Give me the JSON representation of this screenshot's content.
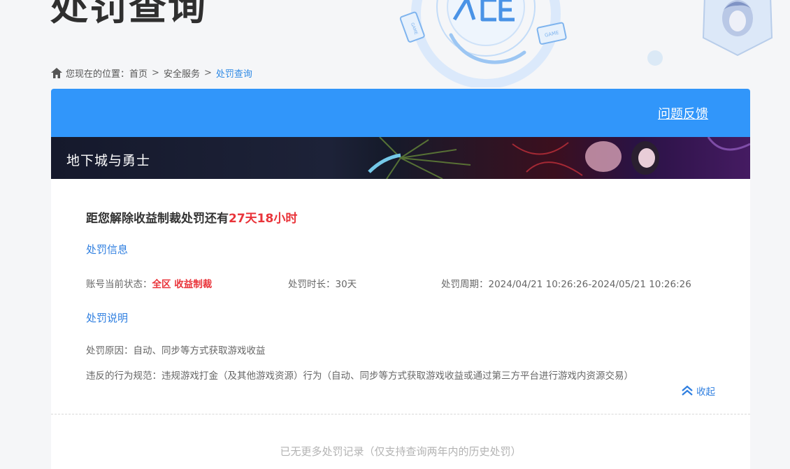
{
  "header": {
    "page_title": "处罚查询"
  },
  "breadcrumb": {
    "prefix": "您现在的位置：",
    "items": [
      "首页",
      "安全服务",
      "处罚查询"
    ],
    "separator": ">"
  },
  "top_bar": {
    "feedback_label": "问题反馈"
  },
  "game": {
    "name": "地下城与勇士"
  },
  "penalty": {
    "countdown_prefix": "距您解除收益制裁处罚还有",
    "countdown_remaining": "27天18小时",
    "info_title": "处罚信息",
    "status_label": "账号当前状态：",
    "status_value": "全区 收益制裁",
    "duration_label": "处罚时长：",
    "duration_value": "30天",
    "period_label": "处罚周期：",
    "period_value": "2024/04/21 10:26:26-2024/05/21 10:26:26",
    "explain_title": "处罚说明",
    "reason_label": "处罚原因：",
    "reason_value": "自动、同步等方式获取游戏收益",
    "rule_label": "违反的行为规范：",
    "rule_value": "违规游戏打金（及其他游戏资源）行为（自动、同步等方式获取游戏收益或通过第三方平台进行游戏内资源交易）",
    "collapse_label": "收起"
  },
  "footer": {
    "no_more_text": "已无更多处罚记录（仅支持查询两年内的历史处罚）"
  },
  "colors": {
    "accent_blue": "#3196fa",
    "link_blue": "#2f7fe0",
    "alert_red": "#e9343a"
  }
}
